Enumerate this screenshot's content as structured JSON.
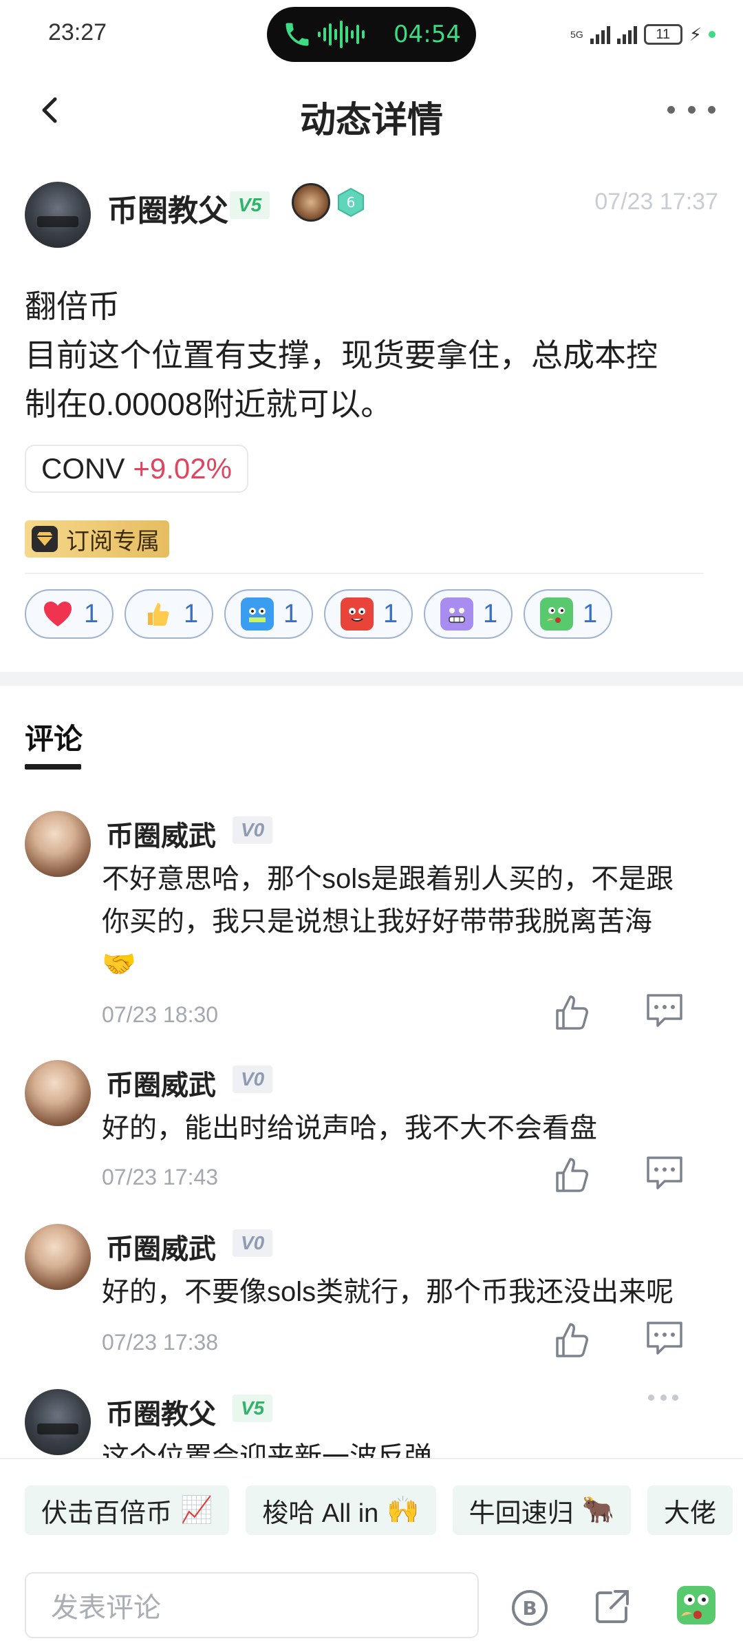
{
  "status_bar": {
    "time": "23:27",
    "call_timer": "04:54",
    "network_label": "5G",
    "battery_level": "11",
    "colors": {
      "call_accent": "#3ddc84"
    }
  },
  "header": {
    "title": "动态详情"
  },
  "post": {
    "author": "币圈教父",
    "author_level": "V5",
    "badge_number": "6",
    "time": "07/23 17:37",
    "lines": [
      "翻倍币",
      "目前这个位置有支撑，现货要拿住，总成本控",
      "制在0.00008附近就可以。"
    ],
    "coin_tag": {
      "symbol": "CONV",
      "change": "+9.02%"
    },
    "subscription_label": "订阅专属",
    "reactions": [
      {
        "icon": "heart-icon",
        "count": "1"
      },
      {
        "icon": "thumbs-up-icon",
        "count": "1"
      },
      {
        "icon": "hodl-robot-icon",
        "count": "1"
      },
      {
        "icon": "angry-face-icon",
        "count": "1"
      },
      {
        "icon": "grimace-face-icon",
        "count": "1"
      },
      {
        "icon": "thinking-face-icon",
        "count": "1"
      }
    ]
  },
  "comments_tab": "评论",
  "comments": [
    {
      "name": "币圈威武",
      "level": "V0",
      "lines": [
        "不好意思哈，那个sols是跟着别人买的，不是跟",
        "你买的，我只是说想让我好好带带我脱离苦海"
      ],
      "emoji": "🤝",
      "time": "07/23 18:30"
    },
    {
      "name": "币圈威武",
      "level": "V0",
      "lines": [
        "好的，能出时给说声哈，我不大不会看盘"
      ],
      "time": "07/23 17:43"
    },
    {
      "name": "币圈威武",
      "level": "V0",
      "lines": [
        "好的，不要像sols类就行，那个币我还没出来呢"
      ],
      "time": "07/23 17:38"
    },
    {
      "name": "币圈教父",
      "level": "V5",
      "lines": [
        "这个位置会迎来新一波反弹"
      ]
    }
  ],
  "quick_replies": [
    {
      "text": "伏击百倍币",
      "emoji": "📈"
    },
    {
      "text": "梭哈 All in",
      "emoji": "🙌"
    },
    {
      "text": "牛回速归",
      "emoji": "🐂"
    },
    {
      "text": "大佬",
      "emoji": ""
    }
  ],
  "composer": {
    "placeholder": "发表评论"
  }
}
